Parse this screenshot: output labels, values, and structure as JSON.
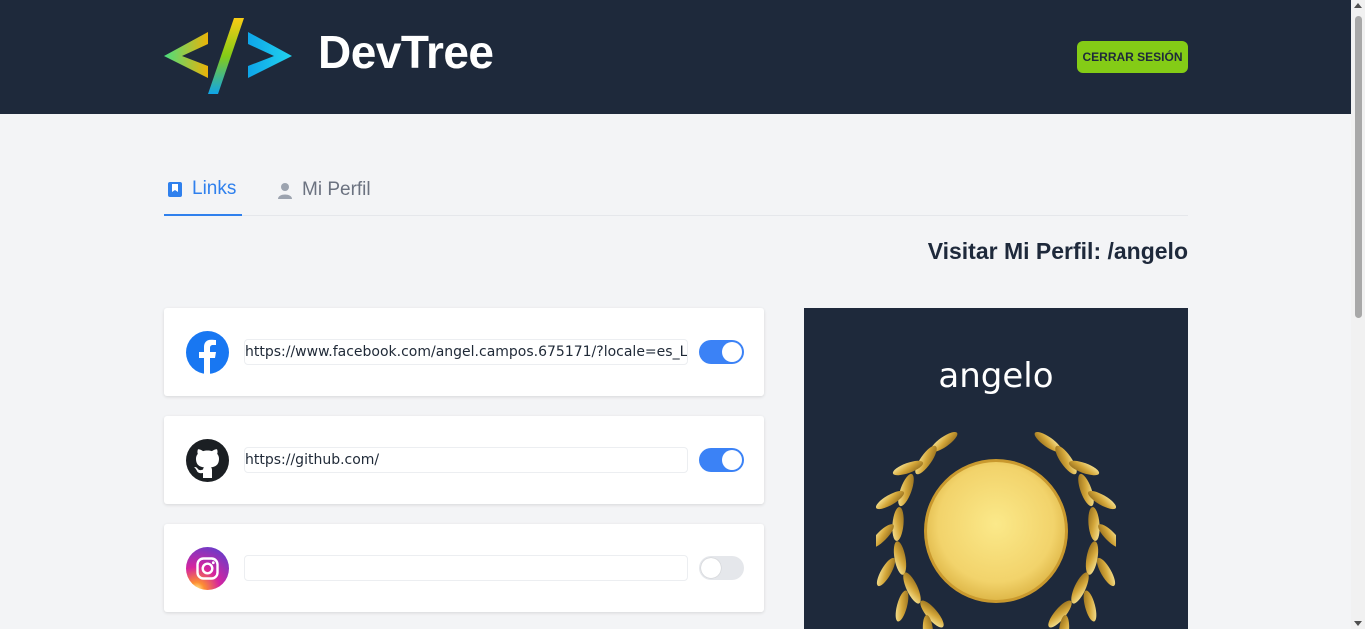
{
  "header": {
    "brand": "DevTree",
    "logout_label": "Cerrar Sesión",
    "logo_icon": "code-brackets-logo"
  },
  "tabs": [
    {
      "label": "Links",
      "icon": "bookmark-icon",
      "active": true
    },
    {
      "label": "Mi Perfil",
      "icon": "user-icon",
      "active": false
    }
  ],
  "visit_profile": "Visitar Mi Perfil: /angelo",
  "links": [
    {
      "network": "facebook",
      "icon": "facebook-icon",
      "url": "https://www.facebook.com/angel.campos.675171/?locale=es_L",
      "enabled": true
    },
    {
      "network": "github",
      "icon": "github-icon",
      "url": "https://github.com/",
      "enabled": true
    },
    {
      "network": "instagram",
      "icon": "instagram-icon",
      "url": "",
      "enabled": false
    }
  ],
  "preview": {
    "handle": "angelo",
    "image_icon": "gold-laurel-medal"
  },
  "colors": {
    "header_bg": "#1e293b",
    "accent": "#84cc16",
    "tab_active": "#2f80ed",
    "toggle_on": "#3b82f6"
  }
}
